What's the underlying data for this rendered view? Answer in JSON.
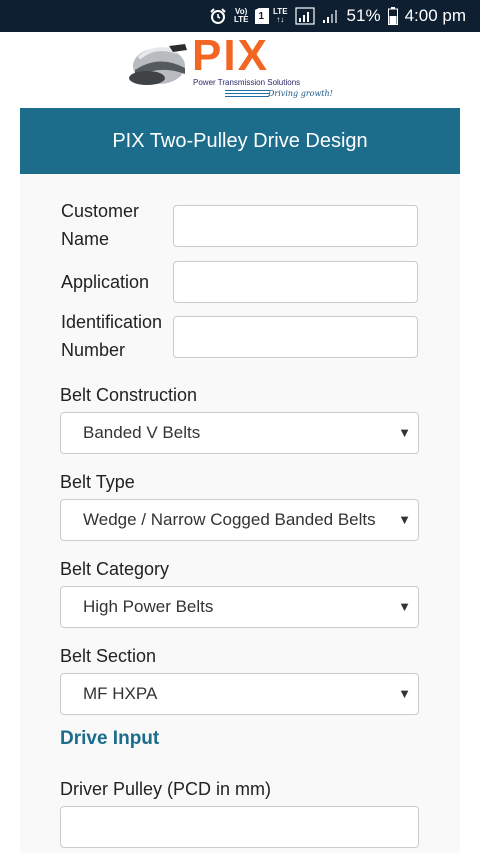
{
  "status_bar": {
    "volte_top": "Vo)",
    "volte_bottom": "LTE",
    "sim_label": "1",
    "lte_label": "LTE",
    "battery_percent": "51%",
    "time": "4:00 pm"
  },
  "logo": {
    "brand": "PIX",
    "subtitle": "Power Transmission Solutions",
    "tagline": "Driving growth!"
  },
  "header": {
    "title": "PIX Two-Pulley Drive Design"
  },
  "form": {
    "customer_name_line1": "Customer",
    "customer_name_line2": "Name",
    "application_label": "Application",
    "identification_line1": "Identification",
    "identification_line2": "Number",
    "belt_construction_label": "Belt Construction",
    "belt_construction_value": "Banded V Belts",
    "belt_type_label": "Belt Type",
    "belt_type_value": "Wedge / Narrow Cogged Banded Belts",
    "belt_category_label": "Belt Category",
    "belt_category_value": "High Power Belts",
    "belt_section_label": "Belt Section",
    "belt_section_value": "MF HXPA",
    "drive_input_title": "Drive Input",
    "driver_pulley_label": "Driver Pulley (PCD in mm)",
    "dropdown_arrow": "▼"
  }
}
